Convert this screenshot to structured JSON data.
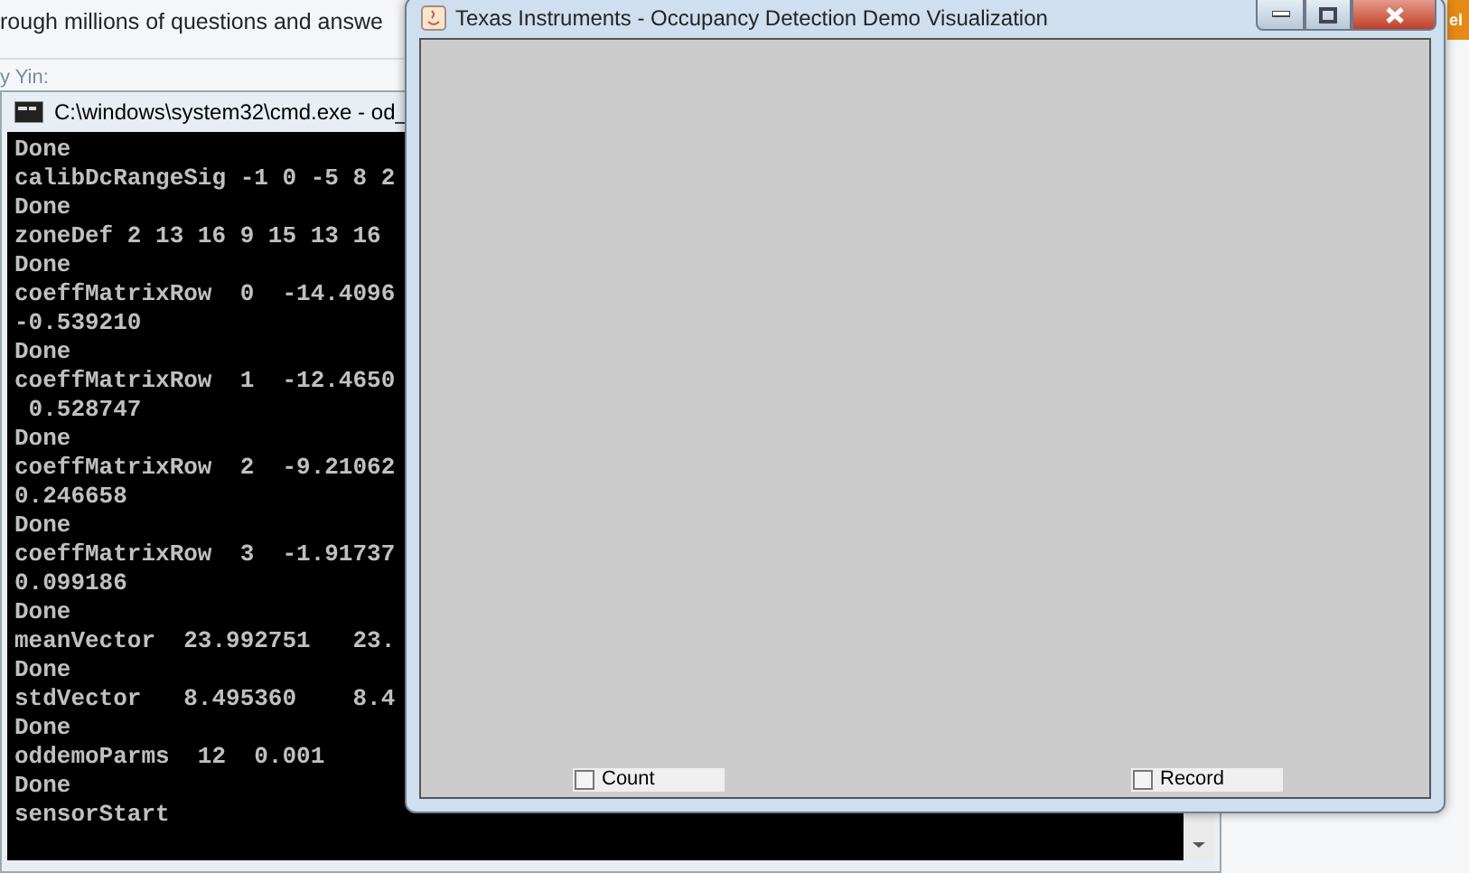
{
  "background_page": {
    "text": "rough millions of questions and answe",
    "fragment": "y Yin:",
    "side_tab": "el"
  },
  "console_window": {
    "title": "C:\\windows\\system32\\cmd.exe - od_",
    "lines": [
      "Done",
      "calibDcRangeSig -1 0 -5 8 2",
      "Done",
      "zoneDef 2 13 16 9 15 13 16",
      "Done",
      "coeffMatrixRow  0  -14.4096",
      "-0.539210",
      "Done",
      "coeffMatrixRow  1  -12.4650",
      " 0.528747",
      "Done",
      "coeffMatrixRow  2  -9.21062",
      "0.246658",
      "Done",
      "coeffMatrixRow  3  -1.91737",
      "0.099186",
      "Done",
      "meanVector  23.992751   23.",
      "Done",
      "stdVector   8.495360    8.4",
      "Done",
      "oddemoParms  12  0.001",
      "Done",
      "sensorStart"
    ]
  },
  "app_window": {
    "title": "Texas Instruments - Occupancy Detection Demo Visualization",
    "checkboxes": [
      {
        "label": "Count",
        "checked": false
      },
      {
        "label": "Record",
        "checked": false
      }
    ]
  }
}
